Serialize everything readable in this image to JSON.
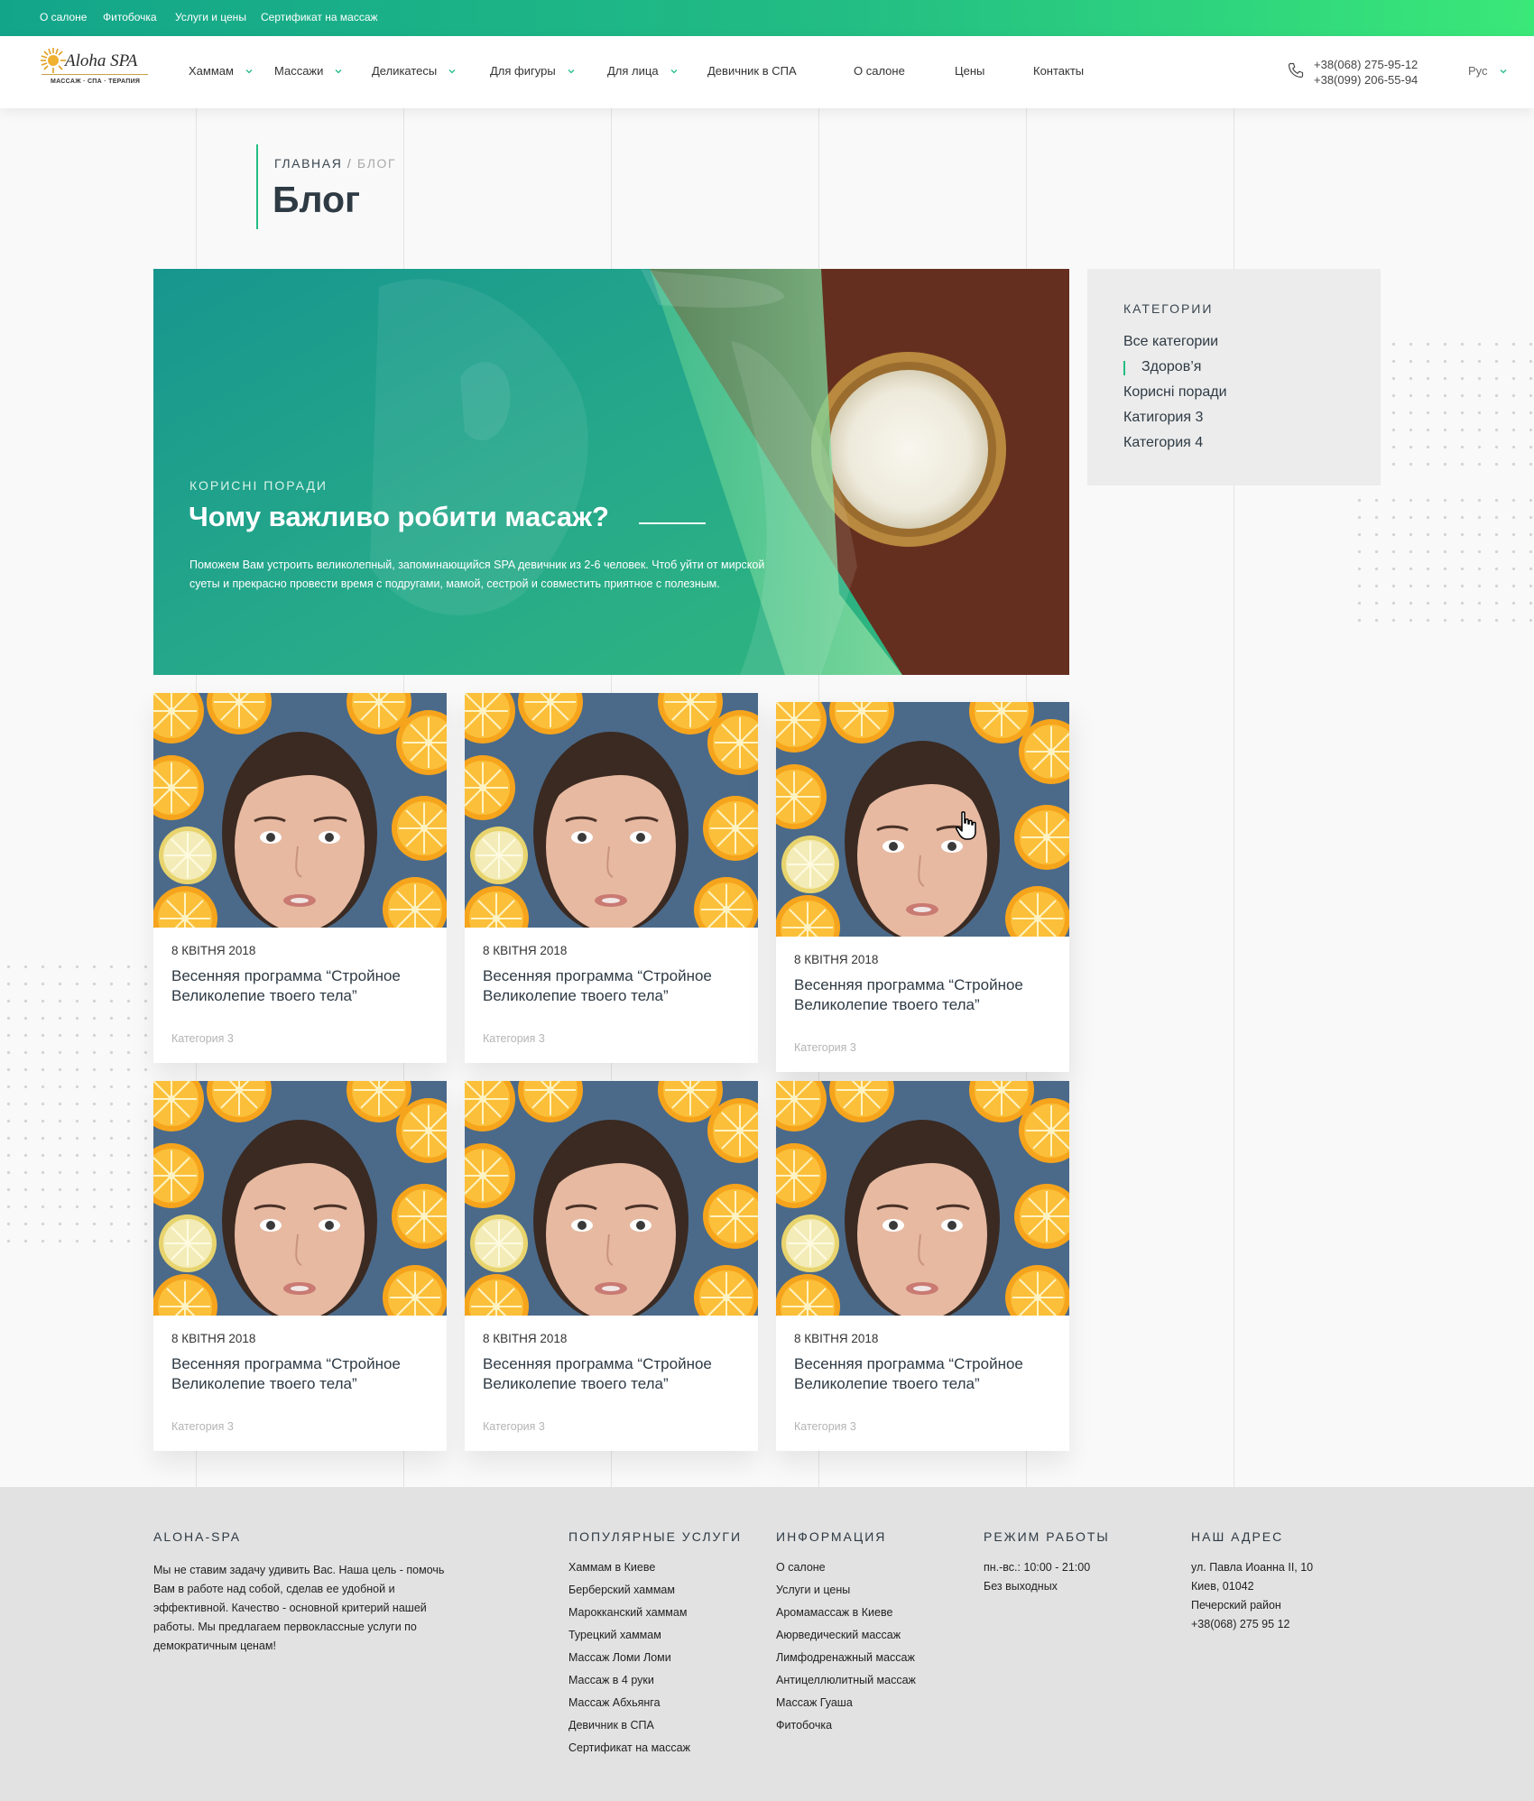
{
  "topbar": {
    "links": [
      "О салоне",
      "Фитобочка",
      "Услуги и цены",
      "Сертификат на массаж"
    ]
  },
  "header": {
    "logo": {
      "name": "Aloha SPA",
      "tagline": "МАССАЖ · СПА · ТЕРАПИЯ"
    },
    "nav": [
      {
        "label": "Хаммам",
        "dropdown": true
      },
      {
        "label": "Массажи",
        "dropdown": true
      },
      {
        "label": "Деликатесы",
        "dropdown": true
      },
      {
        "label": "Для фигуры",
        "dropdown": true
      },
      {
        "label": "Для лица",
        "dropdown": true
      },
      {
        "label": "Девичник в СПА",
        "dropdown": false
      },
      {
        "label": "О салоне",
        "dropdown": false
      },
      {
        "label": "Цены",
        "dropdown": false
      },
      {
        "label": "Контакты",
        "dropdown": false
      }
    ],
    "phones": [
      "+38(068) 275-95-12",
      "+38(099) 206-55-94"
    ],
    "language": "Рус"
  },
  "breadcrumb": {
    "home": "ГЛАВНАЯ",
    "separator": " / ",
    "current": "БЛОГ"
  },
  "page_title": "Блог",
  "hero": {
    "category": "КОРИСНІ ПОРАДИ",
    "title": "Чому важливо робити масаж?",
    "text": "Поможем Вам устроить великолепный, запоминающийся SPA девичник из 2-6 человек. Чтоб уйти от мирской суеты и прекрасно провести время с подругами, мамой, сестрой и совместить приятное с полезным."
  },
  "sidebar": {
    "title": "КАТЕГОРИИ",
    "items": [
      "Все категории",
      "Здоров’я",
      "Корисні поради",
      "Катигория 3",
      "Категория 4"
    ],
    "active_index": 1
  },
  "posts": [
    {
      "date": "8 КВІТНЯ 2018",
      "title": "Весенняя программа “Стройное Великолепие твоего тела”",
      "category": "Категория 3"
    },
    {
      "date": "8 КВІТНЯ 2018",
      "title": "Весенняя программа “Стройное Великолепие твоего тела”",
      "category": "Категория 3"
    },
    {
      "date": "8 КВІТНЯ 2018",
      "title": "Весенняя программа “Стройное Великолепие твоего тела”",
      "category": "Категория 3"
    },
    {
      "date": "8 КВІТНЯ 2018",
      "title": "Весенняя программа “Стройное Великолепие твоего тела”",
      "category": "Категория 3"
    },
    {
      "date": "8 КВІТНЯ 2018",
      "title": "Весенняя программа “Стройное Великолепие твоего тела”",
      "category": "Категория 3"
    },
    {
      "date": "8 КВІТНЯ 2018",
      "title": "Весенняя программа “Стройное Великолепие твоего тела”",
      "category": "Категория 3"
    }
  ],
  "footer": {
    "about": {
      "title": "ALOHA-SPA",
      "text": "Мы не ставим задачу удивить Вас. Наша цель - помочь Вам в работе над собой, сделав ее удобной и эффективной. Качество - основной критерий нашей работы. Мы предлагаем первоклассные услуги по демократичным ценам!"
    },
    "services": {
      "title": "ПОПУЛЯРНЫЕ УСЛУГИ",
      "links": [
        "Хаммам в Киеве",
        "Берберский хаммам",
        "Марокканский хаммам",
        "Турецкий хаммам",
        "Массаж Ломи Ломи",
        "Массаж в 4 руки",
        "Массаж Абхьянга",
        "Девичник в СПА",
        "Сертификат на массаж"
      ]
    },
    "info": {
      "title": "ИНФОРМАЦИЯ",
      "links": [
        "О салоне",
        "Услуги и цены",
        "Аромамассаж в Киеве",
        "Аюрведический массаж",
        "Лимфодренажный массаж",
        "Антицеллюлитный массаж",
        "Массаж Гуаша",
        "Фитобочка"
      ]
    },
    "hours": {
      "title": "РЕЖИМ РАБОТЫ",
      "lines": [
        "пн.-вс.: 10:00 - 21:00",
        "Без выходных"
      ]
    },
    "address": {
      "title": "НАШ АДРЕС",
      "lines": [
        "ул. Павла Иоанна II, 10",
        "Киев, 01042",
        "Печерский район",
        "+38(068) 275 95 12"
      ]
    }
  },
  "colors": {
    "accent": "#22bd84",
    "teal": "#13a58a",
    "footer_bg": "#e2e2e2",
    "sidebar_bg": "#ececec"
  },
  "icons": [
    "phone-icon",
    "chevron-down-icon",
    "hand-cursor-icon",
    "sun-logo-icon"
  ]
}
